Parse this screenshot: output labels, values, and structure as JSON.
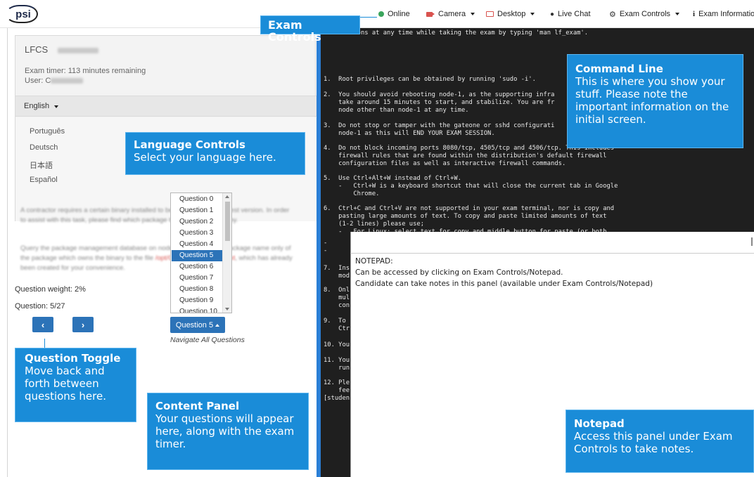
{
  "topbar": {
    "logo": "psi",
    "online": "Online",
    "camera": "Camera",
    "desktop": "Desktop",
    "live_chat": "Live Chat",
    "exam_controls": "Exam Controls",
    "exam_information": "Exam Informatio"
  },
  "left": {
    "exam_name": "LFCS",
    "timer": "Exam timer: 113 minutes remaining",
    "user_label": "User: C",
    "language_selected": "English",
    "languages": [
      "Português",
      "Deutsch",
      "日本語",
      "Español"
    ],
    "question_weight": "Question weight: 2%",
    "question_number": "Question: 5/27",
    "prev_icon": "‹",
    "next_icon": "›",
    "questions": [
      "Question 0",
      "Question 1",
      "Question 2",
      "Question 3",
      "Question 4",
      "Question 5",
      "Question 6",
      "Question 7",
      "Question 8",
      "Question 9",
      "Question 10"
    ],
    "question_select_label": "Question 5",
    "navigate_all": "Navigate All Questions"
  },
  "terminal": {
    "lines": [
      "    uestions at any time while taking the exam by typing 'man lf_exam'.",
      "1.  Root privileges can be obtained by running 'sudo -i'.",
      "2.  You should avoid rebooting node-1, as the supporting infra",
      "    take around 15 minutes to start, and stabilize. You are fr",
      "    node other than node-1 at any time.",
      "3.  Do not stop or tamper with the gateone or sshd configurati",
      "    node-1 as this will END YOUR EXAM SESSION.",
      "4.  Do not block incoming ports 8080/tcp, 4505/tcp and 4506/tcp. This includes",
      "    firewall rules that are found within the distribution's default firewall",
      "    configuration files as well as interactive firewall commands.",
      "5.  Use Ctrl+Alt+W instead of Ctrl+W.",
      "    -   Ctrl+W is a keyboard shortcut that will close the current tab in Google",
      "        Chrome.",
      "6.  Ctrl+C and Ctrl+V are not supported in your exam terminal, nor is copy and",
      "    pasting large amounts of text. To copy and paste limited amounts of text",
      "    (1-2 lines) please use;",
      "    -   For Linux: select text for copy and middle button for paste (or both",
      "-",
      "-",
      "7.  Ins",
      "    mod",
      "8.  Onl",
      "    mul",
      "    con",
      "9.  To",
      "    Ctr",
      "10. You",
      "11. You",
      "    run",
      "12. Ple",
      "    fee",
      "[studen"
    ]
  },
  "notepad": {
    "title": "NOTEPAD:",
    "line1": "Can be accessed by clicking on Exam Controls/Notepad.",
    "line2": "Candidate can take notes in this panel (available under Exam Controls/Notepad)"
  },
  "callouts": {
    "exam_controls": "Exam Controls",
    "command_line_title": "Command Line",
    "command_line_body": "This is where you show your stuff. Please note the important information on the initial screen.",
    "language_title": "Language Controls",
    "language_body": "Select your language here.",
    "question_toggle_title": "Question Toggle",
    "question_toggle_body": "Move back and forth between questions here.",
    "content_title": "Content Panel",
    "content_body": "Your questions will appear here, along with the exam timer.",
    "notepad_title": "Notepad",
    "notepad_body": "Access this panel under Exam Controls to take notes."
  },
  "colors": {
    "accent": "#2c73b8",
    "callout": "#1a8cd8",
    "terminal_bg": "#1f1f1f",
    "online": "#3ba55c",
    "camera": "#d9534f"
  }
}
